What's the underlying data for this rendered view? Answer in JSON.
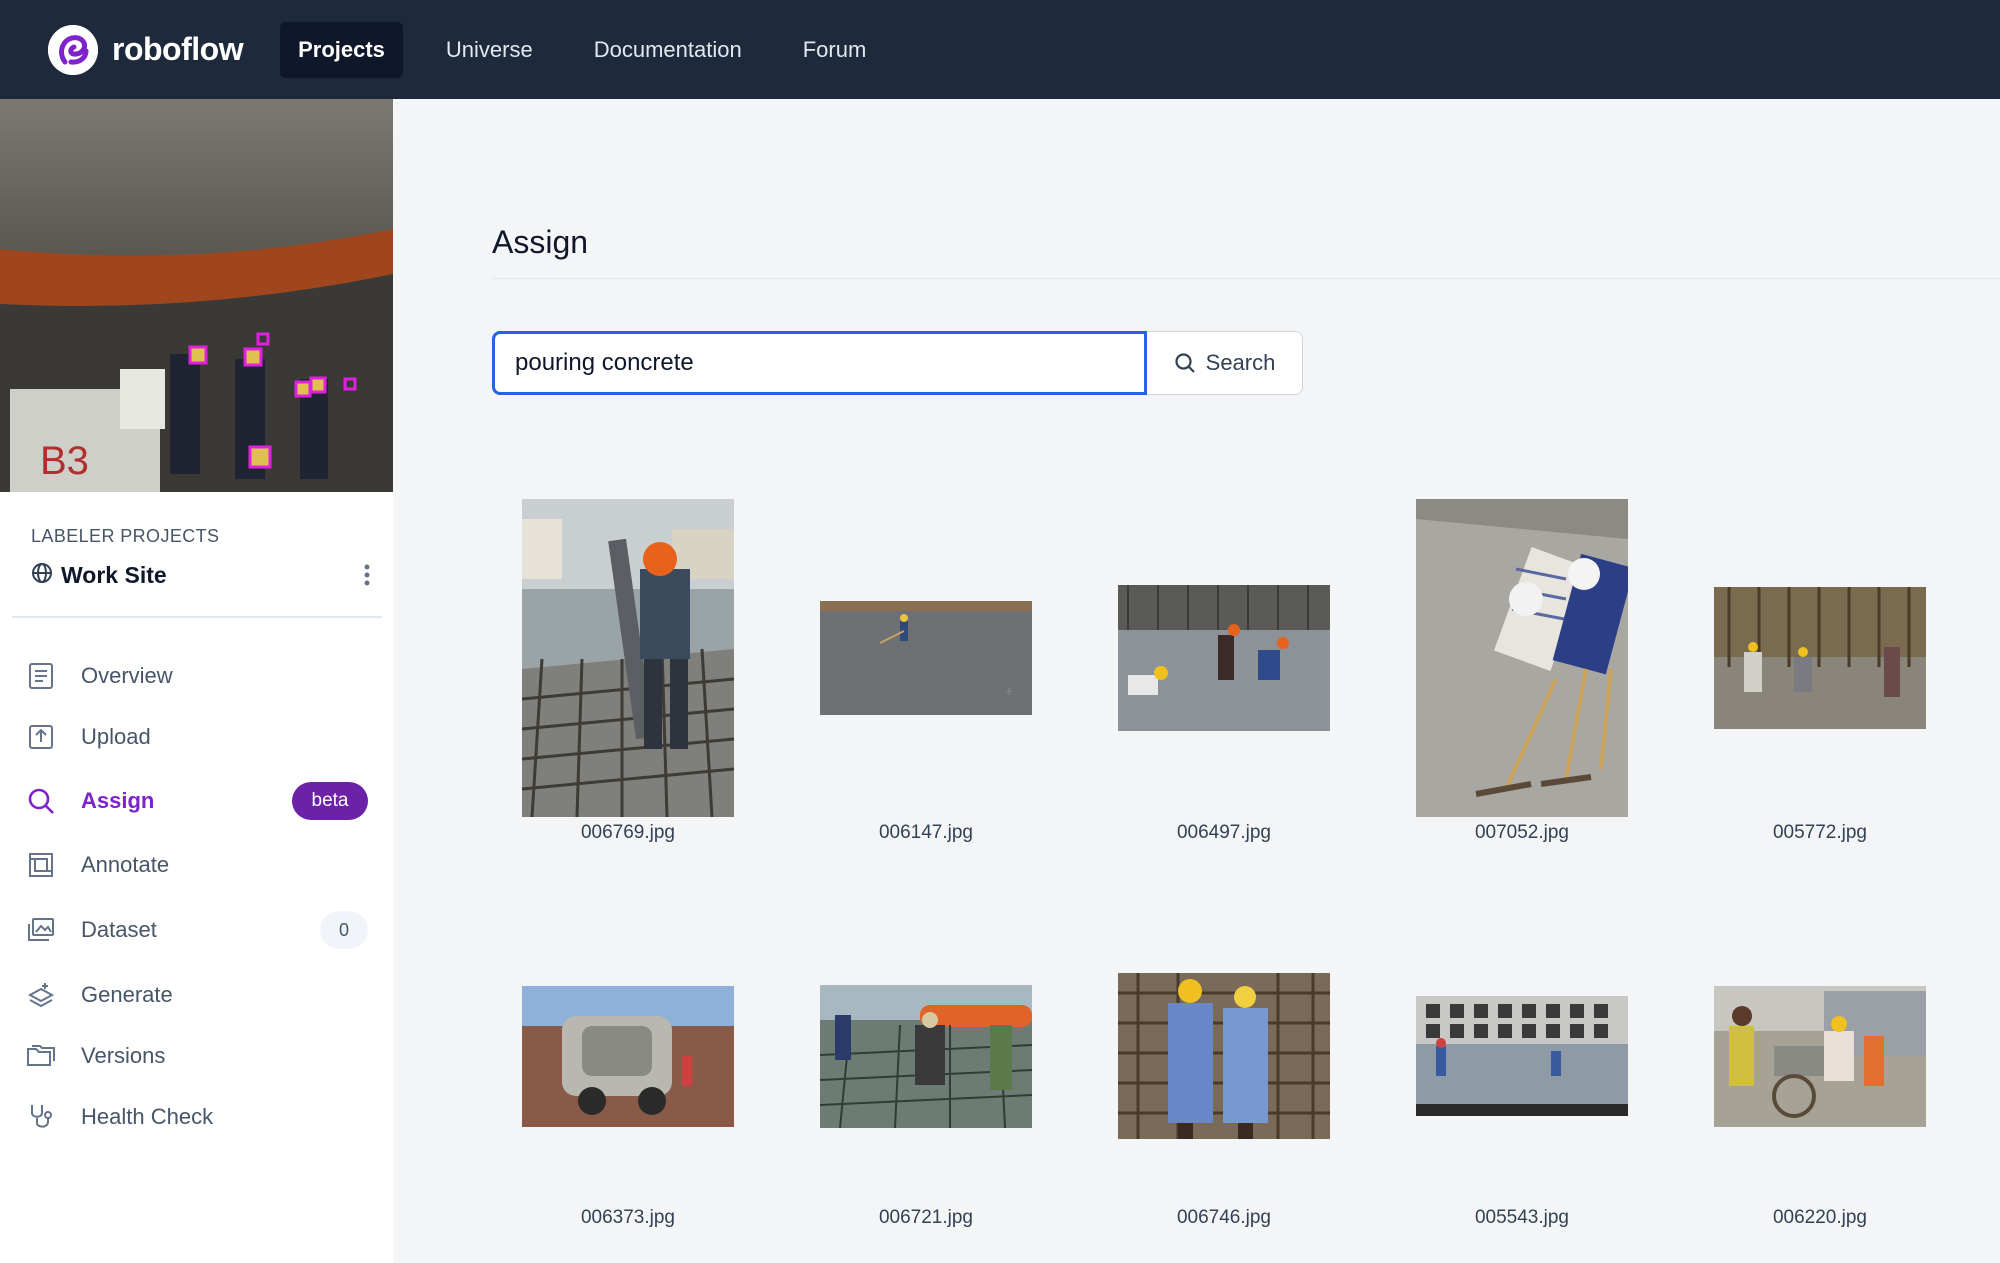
{
  "brand": {
    "name": "roboflow"
  },
  "nav": {
    "items": [
      "Projects",
      "Universe",
      "Documentation",
      "Forum"
    ]
  },
  "sidebar": {
    "section_title": "LABELER PROJECTS",
    "project_name": "Work Site",
    "menu": [
      {
        "label": "Overview",
        "icon": "overview-icon"
      },
      {
        "label": "Upload",
        "icon": "upload-icon"
      },
      {
        "label": "Assign",
        "icon": "search-icon",
        "badge": "beta"
      },
      {
        "label": "Annotate",
        "icon": "annotate-icon"
      },
      {
        "label": "Dataset",
        "icon": "dataset-icon",
        "count": "0"
      },
      {
        "label": "Generate",
        "icon": "generate-icon"
      },
      {
        "label": "Versions",
        "icon": "versions-icon"
      },
      {
        "label": "Health Check",
        "icon": "health-check-icon"
      }
    ]
  },
  "main": {
    "title": "Assign",
    "search": {
      "value": "pouring concrete",
      "button_label": "Search"
    },
    "images": [
      "006769.jpg",
      "006147.jpg",
      "006497.jpg",
      "007052.jpg",
      "005772.jpg",
      "006373.jpg",
      "006721.jpg",
      "006746.jpg",
      "005543.jpg",
      "006220.jpg"
    ]
  },
  "colors": {
    "nav_bg": "#1e293b",
    "accent": "#7e22ce",
    "focus": "#2563eb"
  }
}
